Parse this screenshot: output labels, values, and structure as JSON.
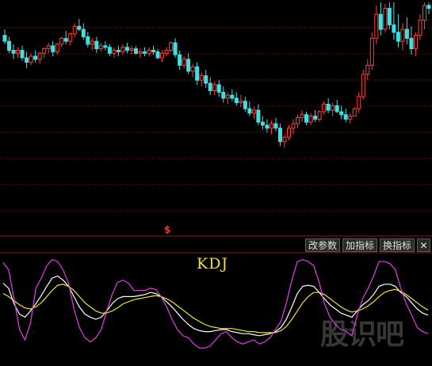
{
  "toolbar": {
    "modify_params": "改参数",
    "add_indicator": "加指标",
    "switch_indicator": "换指标",
    "close": "✕"
  },
  "indicator_title": "KDJ",
  "watermark": "股识吧",
  "signal_marker": "$",
  "colors": {
    "background": "#000000",
    "up": "#ff4040",
    "down": "#40e0e0",
    "k_line": "#ffffff",
    "d_line": "#f0e040",
    "j_line": "#e040e0",
    "grid": "#8a1e1e"
  },
  "chart_data": [
    {
      "type": "candlestick",
      "title": "",
      "xlabel": "",
      "ylabel": "",
      "ylim": [
        0,
        100
      ],
      "grid": "horizontal dotted",
      "candles": [
        [
          78,
          82,
          72,
          74
        ],
        [
          74,
          77,
          66,
          68
        ],
        [
          68,
          72,
          62,
          66
        ],
        [
          66,
          70,
          63,
          68
        ],
        [
          68,
          71,
          61,
          63
        ],
        [
          63,
          67,
          56,
          60
        ],
        [
          60,
          66,
          58,
          64
        ],
        [
          64,
          68,
          60,
          62
        ],
        [
          62,
          67,
          59,
          66
        ],
        [
          66,
          70,
          63,
          69
        ],
        [
          69,
          73,
          66,
          71
        ],
        [
          71,
          74,
          64,
          67
        ],
        [
          67,
          73,
          65,
          72
        ],
        [
          72,
          77,
          70,
          76
        ],
        [
          76,
          81,
          72,
          74
        ],
        [
          74,
          80,
          71,
          79
        ],
        [
          79,
          86,
          77,
          84
        ],
        [
          84,
          89,
          81,
          82
        ],
        [
          82,
          86,
          75,
          77
        ],
        [
          77,
          80,
          70,
          72
        ],
        [
          72,
          76,
          68,
          74
        ],
        [
          74,
          77,
          66,
          69
        ],
        [
          69,
          73,
          67,
          71
        ],
        [
          71,
          74,
          68,
          70
        ],
        [
          70,
          72,
          64,
          66
        ],
        [
          66,
          70,
          63,
          68
        ],
        [
          68,
          71,
          64,
          67
        ],
        [
          67,
          72,
          65,
          70
        ],
        [
          70,
          73,
          66,
          68
        ],
        [
          68,
          71,
          65,
          69
        ],
        [
          69,
          71,
          65,
          66
        ],
        [
          66,
          69,
          63,
          67
        ],
        [
          67,
          70,
          64,
          66
        ],
        [
          66,
          70,
          64,
          68
        ],
        [
          68,
          71,
          65,
          67
        ],
        [
          67,
          69,
          62,
          63
        ],
        [
          63,
          68,
          60,
          66
        ],
        [
          66,
          70,
          64,
          68
        ],
        [
          68,
          74,
          67,
          73
        ],
        [
          73,
          76,
          63,
          65
        ],
        [
          65,
          68,
          55,
          58
        ],
        [
          58,
          64,
          56,
          62
        ],
        [
          62,
          66,
          52,
          54
        ],
        [
          54,
          59,
          50,
          57
        ],
        [
          57,
          60,
          45,
          48
        ],
        [
          48,
          53,
          44,
          51
        ],
        [
          51,
          55,
          43,
          46
        ],
        [
          46,
          50,
          38,
          41
        ],
        [
          41,
          47,
          38,
          45
        ],
        [
          45,
          48,
          37,
          40
        ],
        [
          40,
          44,
          33,
          36
        ],
        [
          36,
          40,
          32,
          38
        ],
        [
          38,
          42,
          34,
          36
        ],
        [
          36,
          40,
          31,
          33
        ],
        [
          33,
          38,
          30,
          34
        ],
        [
          34,
          37,
          27,
          29
        ],
        [
          29,
          34,
          24,
          26
        ],
        [
          26,
          30,
          22,
          28
        ],
        [
          28,
          32,
          18,
          20
        ],
        [
          20,
          24,
          15,
          18
        ],
        [
          18,
          22,
          13,
          16
        ],
        [
          16,
          21,
          12,
          19
        ],
        [
          19,
          23,
          14,
          16
        ],
        [
          16,
          19,
          4,
          7
        ],
        [
          7,
          12,
          3,
          10
        ],
        [
          10,
          18,
          8,
          16
        ],
        [
          16,
          22,
          12,
          19
        ],
        [
          19,
          25,
          16,
          23
        ],
        [
          23,
          28,
          20,
          25
        ],
        [
          25,
          27,
          18,
          20
        ],
        [
          20,
          26,
          18,
          24
        ],
        [
          24,
          28,
          20,
          22
        ],
        [
          22,
          28,
          20,
          27
        ],
        [
          27,
          34,
          25,
          32
        ],
        [
          32,
          36,
          26,
          28
        ],
        [
          28,
          33,
          24,
          31
        ],
        [
          31,
          35,
          26,
          27
        ],
        [
          27,
          31,
          22,
          25
        ],
        [
          25,
          29,
          20,
          22
        ],
        [
          22,
          26,
          19,
          24
        ],
        [
          24,
          30,
          27,
          29
        ],
        [
          29,
          40,
          26,
          37
        ],
        [
          37,
          55,
          35,
          52
        ],
        [
          52,
          62,
          48,
          58
        ],
        [
          58,
          80,
          55,
          76
        ],
        [
          76,
          98,
          72,
          92
        ],
        [
          92,
          100,
          78,
          82
        ],
        [
          82,
          99,
          80,
          96
        ],
        [
          96,
          100,
          82,
          85
        ],
        [
          85,
          100,
          75,
          80
        ],
        [
          80,
          92,
          70,
          74
        ],
        [
          74,
          86,
          68,
          82
        ],
        [
          82,
          90,
          72,
          76
        ],
        [
          76,
          84,
          65,
          69
        ],
        [
          69,
          80,
          64,
          78
        ],
        [
          78,
          92,
          75,
          88
        ],
        [
          88,
          100,
          82,
          98
        ],
        [
          98,
          100,
          92,
          96
        ]
      ]
    },
    {
      "type": "line",
      "title": "KDJ",
      "xlabel": "",
      "ylabel": "",
      "ylim": [
        0,
        100
      ],
      "series": [
        {
          "values": [
            75,
            70,
            55,
            45,
            42,
            48,
            55,
            63,
            72,
            80,
            82,
            78,
            72,
            62,
            52,
            45,
            42,
            40,
            42,
            48,
            55,
            60,
            62,
            62,
            62,
            63,
            64,
            66,
            65,
            62,
            57,
            52,
            46,
            40,
            35,
            31,
            29,
            28,
            28,
            29,
            30,
            30,
            28,
            27,
            26,
            26,
            25,
            24,
            25,
            26,
            28,
            32,
            40,
            52,
            65,
            72,
            73,
            72,
            66,
            60,
            54,
            50,
            46,
            44,
            42,
            48,
            54,
            58,
            64,
            72,
            74,
            74,
            72,
            66,
            62,
            56,
            50,
            46,
            44
          ]
        },
        {
          "values": [
            65,
            62,
            58,
            54,
            51,
            50,
            52,
            56,
            62,
            68,
            73,
            74,
            72,
            68,
            62,
            56,
            52,
            48,
            46,
            46,
            48,
            51,
            55,
            57,
            59,
            60,
            61,
            62,
            63,
            62,
            60,
            57,
            53,
            49,
            45,
            41,
            38,
            35,
            33,
            32,
            31,
            31,
            31,
            30,
            29,
            28,
            28,
            27,
            27,
            27,
            27,
            29,
            33,
            40,
            48,
            56,
            62,
            66,
            66,
            64,
            60,
            56,
            52,
            49,
            47,
            48,
            50,
            53,
            57,
            62,
            66,
            68,
            69,
            67,
            64,
            60,
            56,
            52,
            49
          ]
        },
        {
          "values": [
            95,
            88,
            60,
            30,
            20,
            36,
            70,
            80,
            92,
            98,
            96,
            88,
            75,
            50,
            32,
            22,
            18,
            22,
            30,
            48,
            64,
            76,
            78,
            75,
            68,
            68,
            68,
            70,
            69,
            62,
            52,
            40,
            30,
            24,
            22,
            16,
            12,
            12,
            14,
            20,
            26,
            28,
            22,
            18,
            16,
            18,
            20,
            16,
            18,
            22,
            30,
            38,
            56,
            78,
            96,
            98,
            96,
            92,
            76,
            55,
            42,
            35,
            30,
            28,
            24,
            44,
            60,
            70,
            82,
            96,
            96,
            94,
            88,
            70,
            55,
            44,
            32,
            28,
            26
          ]
        }
      ]
    }
  ]
}
